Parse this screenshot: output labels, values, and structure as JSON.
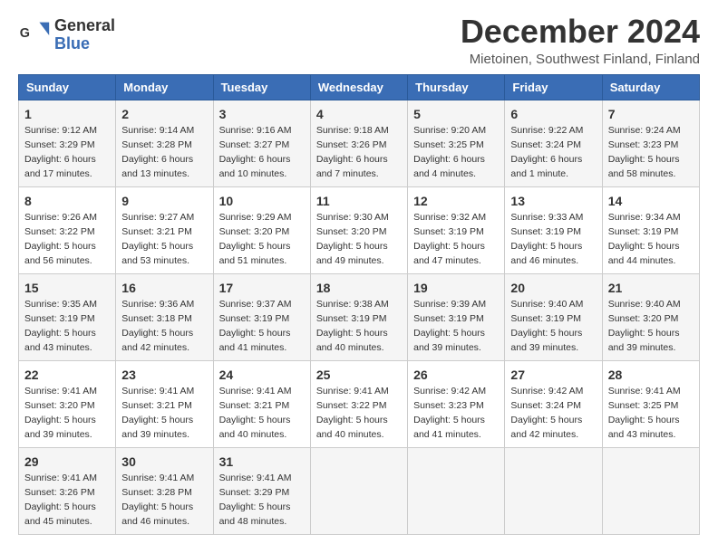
{
  "logo": {
    "text_top": "General",
    "text_bottom": "Blue"
  },
  "header": {
    "title": "December 2024",
    "subtitle": "Mietoinen, Southwest Finland, Finland"
  },
  "weekdays": [
    "Sunday",
    "Monday",
    "Tuesday",
    "Wednesday",
    "Thursday",
    "Friday",
    "Saturday"
  ],
  "weeks": [
    [
      {
        "day": "1",
        "sunrise": "9:12 AM",
        "sunset": "3:29 PM",
        "daylight": "6 hours and 17 minutes."
      },
      {
        "day": "2",
        "sunrise": "9:14 AM",
        "sunset": "3:28 PM",
        "daylight": "6 hours and 13 minutes."
      },
      {
        "day": "3",
        "sunrise": "9:16 AM",
        "sunset": "3:27 PM",
        "daylight": "6 hours and 10 minutes."
      },
      {
        "day": "4",
        "sunrise": "9:18 AM",
        "sunset": "3:26 PM",
        "daylight": "6 hours and 7 minutes."
      },
      {
        "day": "5",
        "sunrise": "9:20 AM",
        "sunset": "3:25 PM",
        "daylight": "6 hours and 4 minutes."
      },
      {
        "day": "6",
        "sunrise": "9:22 AM",
        "sunset": "3:24 PM",
        "daylight": "6 hours and 1 minute."
      },
      {
        "day": "7",
        "sunrise": "9:24 AM",
        "sunset": "3:23 PM",
        "daylight": "5 hours and 58 minutes."
      }
    ],
    [
      {
        "day": "8",
        "sunrise": "9:26 AM",
        "sunset": "3:22 PM",
        "daylight": "5 hours and 56 minutes."
      },
      {
        "day": "9",
        "sunrise": "9:27 AM",
        "sunset": "3:21 PM",
        "daylight": "5 hours and 53 minutes."
      },
      {
        "day": "10",
        "sunrise": "9:29 AM",
        "sunset": "3:20 PM",
        "daylight": "5 hours and 51 minutes."
      },
      {
        "day": "11",
        "sunrise": "9:30 AM",
        "sunset": "3:20 PM",
        "daylight": "5 hours and 49 minutes."
      },
      {
        "day": "12",
        "sunrise": "9:32 AM",
        "sunset": "3:19 PM",
        "daylight": "5 hours and 47 minutes."
      },
      {
        "day": "13",
        "sunrise": "9:33 AM",
        "sunset": "3:19 PM",
        "daylight": "5 hours and 46 minutes."
      },
      {
        "day": "14",
        "sunrise": "9:34 AM",
        "sunset": "3:19 PM",
        "daylight": "5 hours and 44 minutes."
      }
    ],
    [
      {
        "day": "15",
        "sunrise": "9:35 AM",
        "sunset": "3:19 PM",
        "daylight": "5 hours and 43 minutes."
      },
      {
        "day": "16",
        "sunrise": "9:36 AM",
        "sunset": "3:18 PM",
        "daylight": "5 hours and 42 minutes."
      },
      {
        "day": "17",
        "sunrise": "9:37 AM",
        "sunset": "3:19 PM",
        "daylight": "5 hours and 41 minutes."
      },
      {
        "day": "18",
        "sunrise": "9:38 AM",
        "sunset": "3:19 PM",
        "daylight": "5 hours and 40 minutes."
      },
      {
        "day": "19",
        "sunrise": "9:39 AM",
        "sunset": "3:19 PM",
        "daylight": "5 hours and 39 minutes."
      },
      {
        "day": "20",
        "sunrise": "9:40 AM",
        "sunset": "3:19 PM",
        "daylight": "5 hours and 39 minutes."
      },
      {
        "day": "21",
        "sunrise": "9:40 AM",
        "sunset": "3:20 PM",
        "daylight": "5 hours and 39 minutes."
      }
    ],
    [
      {
        "day": "22",
        "sunrise": "9:41 AM",
        "sunset": "3:20 PM",
        "daylight": "5 hours and 39 minutes."
      },
      {
        "day": "23",
        "sunrise": "9:41 AM",
        "sunset": "3:21 PM",
        "daylight": "5 hours and 39 minutes."
      },
      {
        "day": "24",
        "sunrise": "9:41 AM",
        "sunset": "3:21 PM",
        "daylight": "5 hours and 40 minutes."
      },
      {
        "day": "25",
        "sunrise": "9:41 AM",
        "sunset": "3:22 PM",
        "daylight": "5 hours and 40 minutes."
      },
      {
        "day": "26",
        "sunrise": "9:42 AM",
        "sunset": "3:23 PM",
        "daylight": "5 hours and 41 minutes."
      },
      {
        "day": "27",
        "sunrise": "9:42 AM",
        "sunset": "3:24 PM",
        "daylight": "5 hours and 42 minutes."
      },
      {
        "day": "28",
        "sunrise": "9:41 AM",
        "sunset": "3:25 PM",
        "daylight": "5 hours and 43 minutes."
      }
    ],
    [
      {
        "day": "29",
        "sunrise": "9:41 AM",
        "sunset": "3:26 PM",
        "daylight": "5 hours and 45 minutes."
      },
      {
        "day": "30",
        "sunrise": "9:41 AM",
        "sunset": "3:28 PM",
        "daylight": "5 hours and 46 minutes."
      },
      {
        "day": "31",
        "sunrise": "9:41 AM",
        "sunset": "3:29 PM",
        "daylight": "5 hours and 48 minutes."
      },
      null,
      null,
      null,
      null
    ]
  ]
}
